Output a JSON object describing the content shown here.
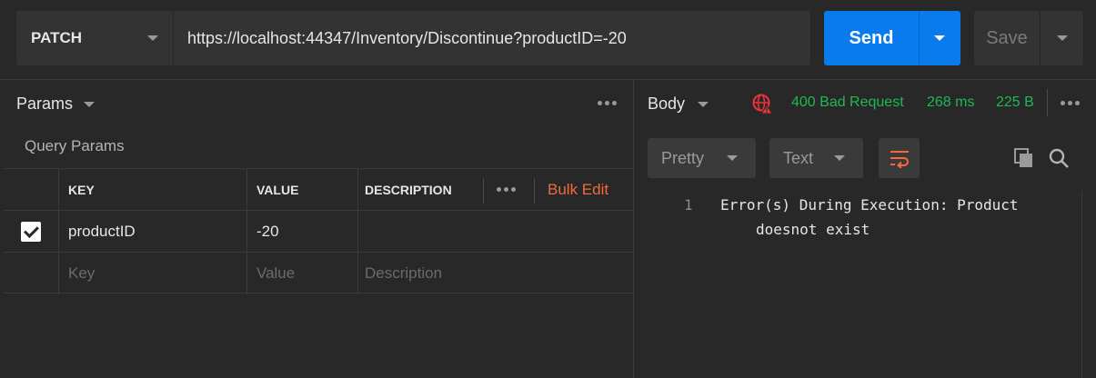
{
  "request": {
    "method": "PATCH",
    "url": "https://localhost:44347/Inventory/Discontinue?productID=-20",
    "send_label": "Send",
    "save_label": "Save"
  },
  "params_panel": {
    "title": "Params",
    "section_title": "Query Params",
    "columns": {
      "key": "KEY",
      "value": "VALUE",
      "description": "DESCRIPTION"
    },
    "bulk_edit_label": "Bulk Edit",
    "rows": [
      {
        "checked": true,
        "key": "productID",
        "value": "-20",
        "description": ""
      }
    ],
    "placeholders": {
      "key": "Key",
      "value": "Value",
      "description": "Description"
    }
  },
  "response": {
    "title": "Body",
    "status": "400 Bad Request",
    "time": "268 ms",
    "size": "225 B",
    "format_label": "Pretty",
    "type_label": "Text",
    "line_number": "1",
    "line_1": "Error(s) During Execution: Product",
    "line_1_wrap": "doesnot exist"
  },
  "colors": {
    "accent_blue": "#097bed",
    "status_green": "#1db954",
    "bulk_edit_orange": "#f26b3a",
    "error_icon_red": "#e8343a"
  },
  "icons": [
    "chevron-down-icon",
    "more-dots-icon",
    "checkbox-icon",
    "globe-error-icon",
    "wrap-lines-icon",
    "copy-icon",
    "search-icon"
  ]
}
